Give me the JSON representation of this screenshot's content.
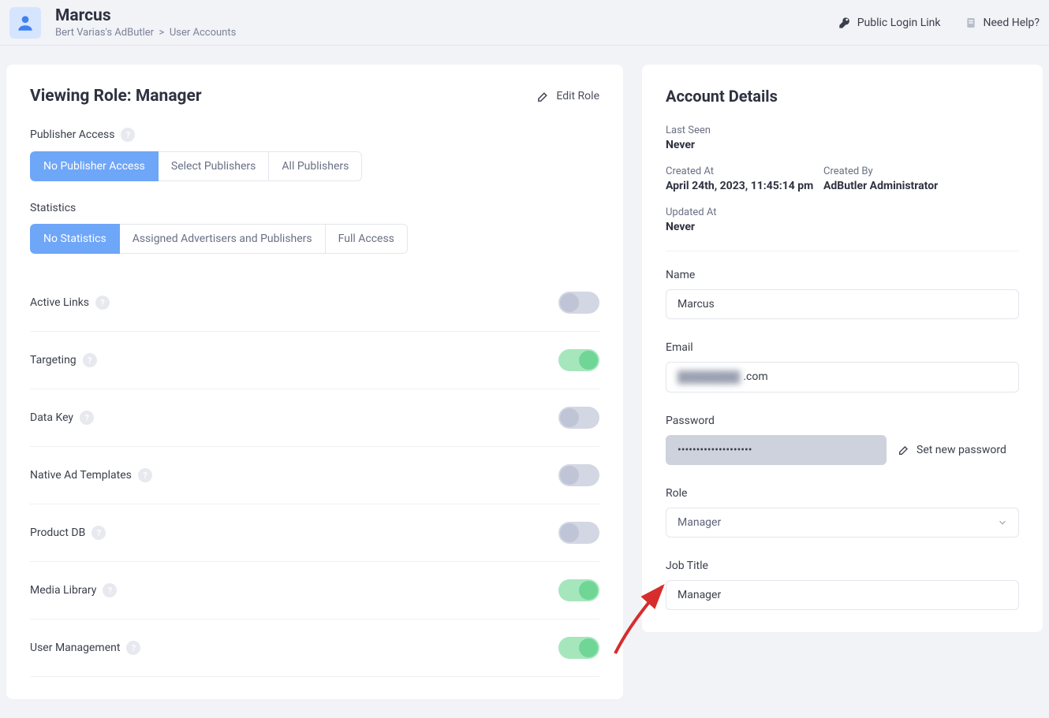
{
  "header": {
    "title": "Marcus",
    "breadcrumb_root": "Bert Varias's AdButler",
    "breadcrumb_sep": ">",
    "breadcrumb_leaf": "User Accounts",
    "public_login": "Public Login Link",
    "need_help": "Need Help?"
  },
  "role_panel": {
    "title": "Viewing Role: Manager",
    "edit_role_label": "Edit Role",
    "publisher_access_label": "Publisher Access",
    "publisher_access_options": [
      "No Publisher Access",
      "Select Publishers",
      "All Publishers"
    ],
    "statistics_label": "Statistics",
    "statistics_options": [
      "No Statistics",
      "Assigned Advertisers and Publishers",
      "Full Access"
    ],
    "toggles": [
      {
        "label": "Active Links",
        "on": false
      },
      {
        "label": "Targeting",
        "on": true
      },
      {
        "label": "Data Key",
        "on": false
      },
      {
        "label": "Native Ad Templates",
        "on": false
      },
      {
        "label": "Product DB",
        "on": false
      },
      {
        "label": "Media Library",
        "on": true
      },
      {
        "label": "User Management",
        "on": true
      }
    ]
  },
  "details": {
    "title": "Account Details",
    "last_seen_label": "Last Seen",
    "last_seen_value": "Never",
    "created_at_label": "Created At",
    "created_at_value": "April 24th, 2023, 11:45:14 pm",
    "created_by_label": "Created By",
    "created_by_value": "AdButler Administrator",
    "updated_at_label": "Updated At",
    "updated_at_value": "Never",
    "name_label": "Name",
    "name_value": "Marcus",
    "email_label": "Email",
    "email_hidden": "████████",
    "email_suffix": ".com",
    "password_label": "Password",
    "password_value": "••••••••••••••••••••",
    "set_password_label": "Set new password",
    "role_label": "Role",
    "role_value": "Manager",
    "job_title_label": "Job Title",
    "job_title_value": "Manager"
  }
}
